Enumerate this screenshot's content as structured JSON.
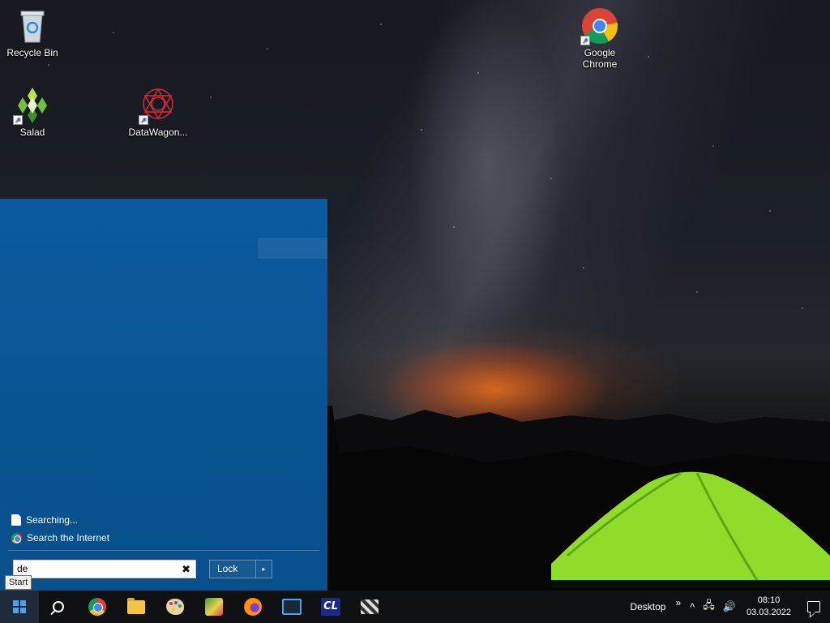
{
  "desktop": {
    "icons": [
      {
        "label": "Recycle Bin"
      },
      {
        "label": "Salad"
      },
      {
        "label": "DataWagon..."
      },
      {
        "label": "Google Chrome"
      }
    ]
  },
  "start_menu": {
    "results": [
      {
        "label": "Searching...",
        "icon": "file-icon"
      },
      {
        "label": "Search the Internet",
        "icon": "chrome-icon"
      }
    ],
    "search": {
      "value": "de",
      "clear_symbol": "✖"
    },
    "lock": {
      "label": "Lock",
      "arrow": "▸"
    },
    "tooltip": "Start"
  },
  "taskbar": {
    "pinned": [
      "search-icon",
      "chrome-icon",
      "file-explorer-icon",
      "paint-icon",
      "maps-icon",
      "firefox-icon",
      "video-editor-icon",
      "cl-icon",
      "clapper-icon"
    ],
    "cl_label": "CL",
    "tray": {
      "desktop_label": "Desktop",
      "chevron": "»",
      "up_arrow": "^",
      "network": "🖧",
      "volume": "🔊",
      "time": "08:10",
      "date": "03.03.2022"
    }
  },
  "colors": {
    "start_menu_bg": "#0a5393",
    "taskbar_bg": "#0f1014",
    "accent": "#4aa3ef"
  }
}
